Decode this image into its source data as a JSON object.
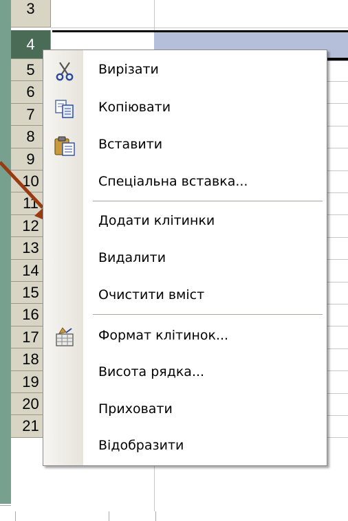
{
  "sheet": {
    "row_numbers": [
      "3",
      "4",
      "5",
      "6",
      "7",
      "8",
      "9",
      "10",
      "11",
      "12",
      "13",
      "14",
      "15",
      "16",
      "17",
      "18",
      "19",
      "20",
      "21"
    ],
    "selected_row": "4"
  },
  "context_menu": {
    "items": [
      {
        "label": "Вирізати",
        "icon": "scissors-icon"
      },
      {
        "label": "Копіювати",
        "icon": "copy-icon"
      },
      {
        "label": "Вставити",
        "icon": "paste-icon"
      },
      {
        "label": "Спеціальна вставка..."
      },
      {
        "label": "Додати клітинки"
      },
      {
        "label": "Видалити"
      },
      {
        "label": "Очистити вміст"
      },
      {
        "label": "Формат клітинок...",
        "icon": "format-cells-icon"
      },
      {
        "label": "Висота рядка..."
      },
      {
        "label": "Приховати"
      },
      {
        "label": "Відобразити"
      }
    ]
  },
  "colors": {
    "background": "#77a08f",
    "row_header": "#d9d5c5",
    "selected_row_header": "#4a6b56",
    "selection_fill": "#b6bfd9",
    "arrow": "#9a3a12"
  }
}
